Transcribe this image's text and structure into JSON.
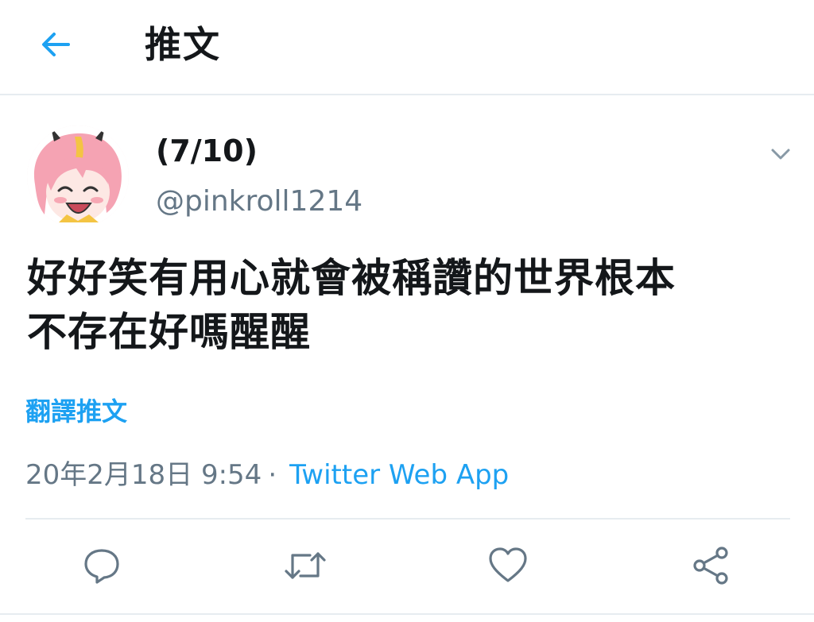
{
  "header": {
    "title": "推文",
    "back_icon": "arrow-left-icon"
  },
  "tweet": {
    "display_name": "(7/10)",
    "handle": "@pinkroll1214",
    "text_line1": "好好笑有用心就會被稱讚的世界根本",
    "text_line2": "不存在好嗎醒醒",
    "translate_label": "翻譯推文",
    "timestamp": "20年2月18日 9:54",
    "separator": "·",
    "source": "Twitter Web App"
  },
  "actions": {
    "reply_icon": "reply-icon",
    "retweet_icon": "retweet-icon",
    "like_icon": "heart-icon",
    "share_icon": "share-icon"
  },
  "colors": {
    "accent": "#1da1f2",
    "secondary_text": "#657786",
    "divider": "#e6ecf0",
    "text": "#14171a"
  }
}
